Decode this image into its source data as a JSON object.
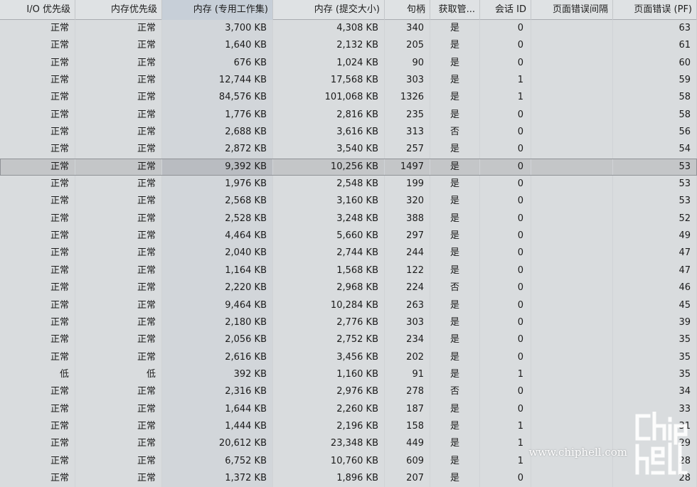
{
  "columns": [
    {
      "key": "io_priority",
      "label": "I/O 优先级"
    },
    {
      "key": "mem_priority",
      "label": "内存优先级"
    },
    {
      "key": "mem_private",
      "label": "内存 (专用工作集)"
    },
    {
      "key": "mem_commit",
      "label": "内存 (提交大小)"
    },
    {
      "key": "handles",
      "label": "句柄"
    },
    {
      "key": "elevated",
      "label": "获取管..."
    },
    {
      "key": "session_id",
      "label": "会话 ID"
    },
    {
      "key": "pf_delta",
      "label": "页面错误间隔"
    },
    {
      "key": "page_faults",
      "label": "页面错误 (PF)"
    }
  ],
  "sorted_column": "page_faults",
  "selected_row": 8,
  "rows": [
    [
      "正常",
      "正常",
      "3,700 KB",
      "4,308 KB",
      "340",
      "是",
      "0",
      "",
      "63"
    ],
    [
      "正常",
      "正常",
      "1,640 KB",
      "2,132 KB",
      "205",
      "是",
      "0",
      "",
      "61"
    ],
    [
      "正常",
      "正常",
      "676 KB",
      "1,024 KB",
      "90",
      "是",
      "0",
      "",
      "60"
    ],
    [
      "正常",
      "正常",
      "12,744 KB",
      "17,568 KB",
      "303",
      "是",
      "1",
      "",
      "59"
    ],
    [
      "正常",
      "正常",
      "84,576 KB",
      "101,068 KB",
      "1326",
      "是",
      "1",
      "",
      "58"
    ],
    [
      "正常",
      "正常",
      "1,776 KB",
      "2,816 KB",
      "235",
      "是",
      "0",
      "",
      "58"
    ],
    [
      "正常",
      "正常",
      "2,688 KB",
      "3,616 KB",
      "313",
      "否",
      "0",
      "",
      "56"
    ],
    [
      "正常",
      "正常",
      "2,872 KB",
      "3,540 KB",
      "257",
      "是",
      "0",
      "",
      "54"
    ],
    [
      "正常",
      "正常",
      "9,392 KB",
      "10,256 KB",
      "1497",
      "是",
      "0",
      "",
      "53"
    ],
    [
      "正常",
      "正常",
      "1,976 KB",
      "2,548 KB",
      "199",
      "是",
      "0",
      "",
      "53"
    ],
    [
      "正常",
      "正常",
      "2,568 KB",
      "3,160 KB",
      "320",
      "是",
      "0",
      "",
      "53"
    ],
    [
      "正常",
      "正常",
      "2,528 KB",
      "3,248 KB",
      "388",
      "是",
      "0",
      "",
      "52"
    ],
    [
      "正常",
      "正常",
      "4,464 KB",
      "5,660 KB",
      "297",
      "是",
      "0",
      "",
      "49"
    ],
    [
      "正常",
      "正常",
      "2,040 KB",
      "2,744 KB",
      "244",
      "是",
      "0",
      "",
      "47"
    ],
    [
      "正常",
      "正常",
      "1,164 KB",
      "1,568 KB",
      "122",
      "是",
      "0",
      "",
      "47"
    ],
    [
      "正常",
      "正常",
      "2,220 KB",
      "2,968 KB",
      "224",
      "否",
      "0",
      "",
      "46"
    ],
    [
      "正常",
      "正常",
      "9,464 KB",
      "10,284 KB",
      "263",
      "是",
      "0",
      "",
      "45"
    ],
    [
      "正常",
      "正常",
      "2,180 KB",
      "2,776 KB",
      "303",
      "是",
      "0",
      "",
      "39"
    ],
    [
      "正常",
      "正常",
      "2,056 KB",
      "2,752 KB",
      "234",
      "是",
      "0",
      "",
      "35"
    ],
    [
      "正常",
      "正常",
      "2,616 KB",
      "3,456 KB",
      "202",
      "是",
      "0",
      "",
      "35"
    ],
    [
      "低",
      "低",
      "392 KB",
      "1,160 KB",
      "91",
      "是",
      "1",
      "",
      "35"
    ],
    [
      "正常",
      "正常",
      "2,316 KB",
      "2,976 KB",
      "278",
      "否",
      "0",
      "",
      "34"
    ],
    [
      "正常",
      "正常",
      "1,644 KB",
      "2,260 KB",
      "187",
      "是",
      "0",
      "",
      "33"
    ],
    [
      "正常",
      "正常",
      "1,444 KB",
      "2,196 KB",
      "158",
      "是",
      "1",
      "",
      "31"
    ],
    [
      "正常",
      "正常",
      "20,612 KB",
      "23,348 KB",
      "449",
      "是",
      "1",
      "",
      "29"
    ],
    [
      "正常",
      "正常",
      "6,752 KB",
      "10,760 KB",
      "609",
      "是",
      "1",
      "",
      "28"
    ],
    [
      "正常",
      "正常",
      "1,372 KB",
      "1,896 KB",
      "207",
      "是",
      "0",
      "",
      "28"
    ]
  ],
  "watermark": {
    "url": "www.chiphell.com",
    "logo_text": "chiphell"
  }
}
